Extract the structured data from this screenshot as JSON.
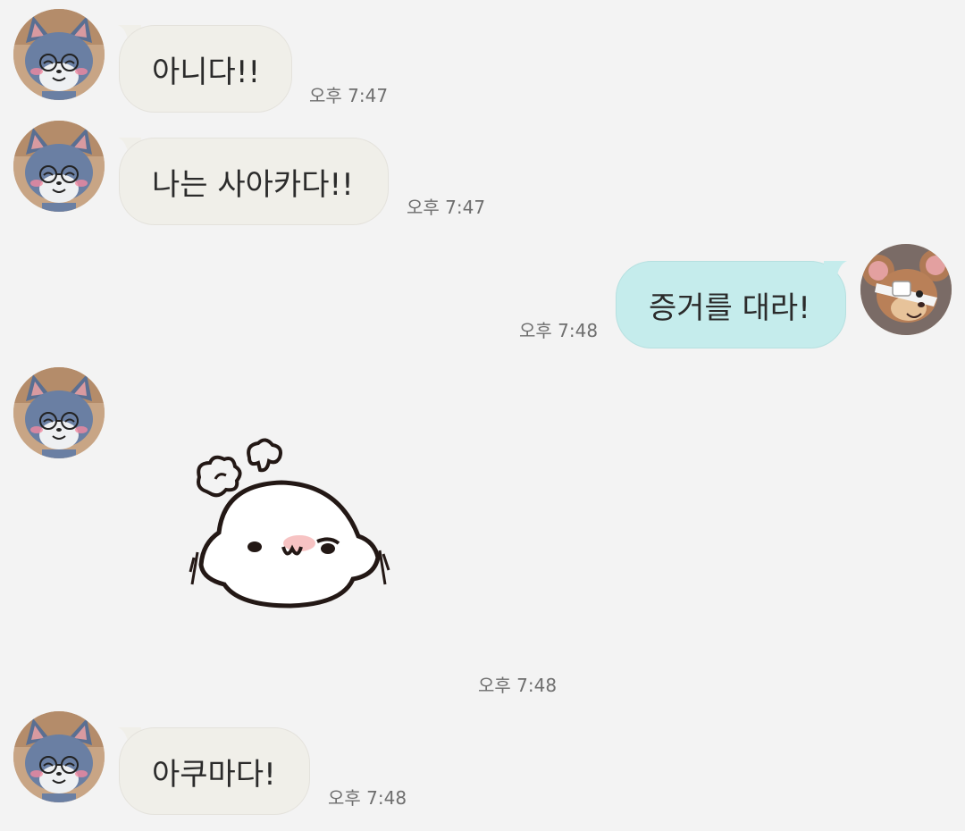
{
  "messages": [
    {
      "sender": "friend",
      "type": "text",
      "text": "아니다!!",
      "time": "오후 7:47"
    },
    {
      "sender": "friend",
      "type": "text",
      "text": "나는 사아카다!!",
      "time": "오후 7:47"
    },
    {
      "sender": "me",
      "type": "text",
      "text": "증거를 대라!",
      "time": "오후 7:48"
    },
    {
      "sender": "friend",
      "type": "sticker",
      "sticker": "angry-seal-sticker",
      "time": "오후 7:48"
    },
    {
      "sender": "friend",
      "type": "text",
      "text": "아쿠마다!",
      "time": "오후 7:48"
    }
  ],
  "colors": {
    "background": "#f3f3f3",
    "incoming_bubble": "#f0efe9",
    "outgoing_bubble": "#c5ecec",
    "timestamp": "#6e6e6e"
  },
  "icons": {
    "friend_avatar": "tom-cat-avatar",
    "my_avatar": "jerry-mouse-avatar"
  }
}
